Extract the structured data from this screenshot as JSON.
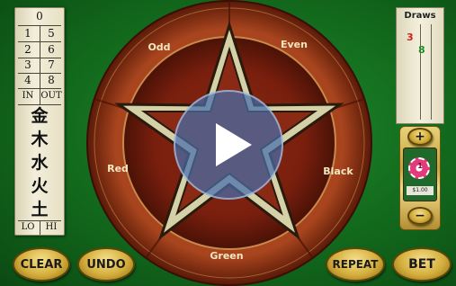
{
  "scroll": {
    "header": "0",
    "pairs": [
      [
        "1",
        "5"
      ],
      [
        "2",
        "6"
      ],
      [
        "3",
        "7"
      ],
      [
        "4",
        "8"
      ]
    ],
    "in_label": "IN",
    "out_label": "OUT",
    "elements": [
      "金",
      "木",
      "水",
      "火",
      "土"
    ],
    "lo_label": "LO",
    "hi_label": "HI"
  },
  "draws": {
    "title": "Draws",
    "values": [
      {
        "text": "3",
        "color": "#d41f1f"
      },
      {
        "text": "8",
        "color": "#1e8a2a"
      }
    ]
  },
  "chip": {
    "plus": "+",
    "minus": "−",
    "value": "1",
    "amount": "$1.00"
  },
  "wheel": {
    "odd": "Odd",
    "even": "Even",
    "red": "Red",
    "black": "Black",
    "green": "Green"
  },
  "buttons": {
    "clear": "CLEAR",
    "undo": "UNDO",
    "repeat": "REPEAT",
    "bet": "BET"
  },
  "overlay": {
    "play_icon": "play-icon"
  }
}
